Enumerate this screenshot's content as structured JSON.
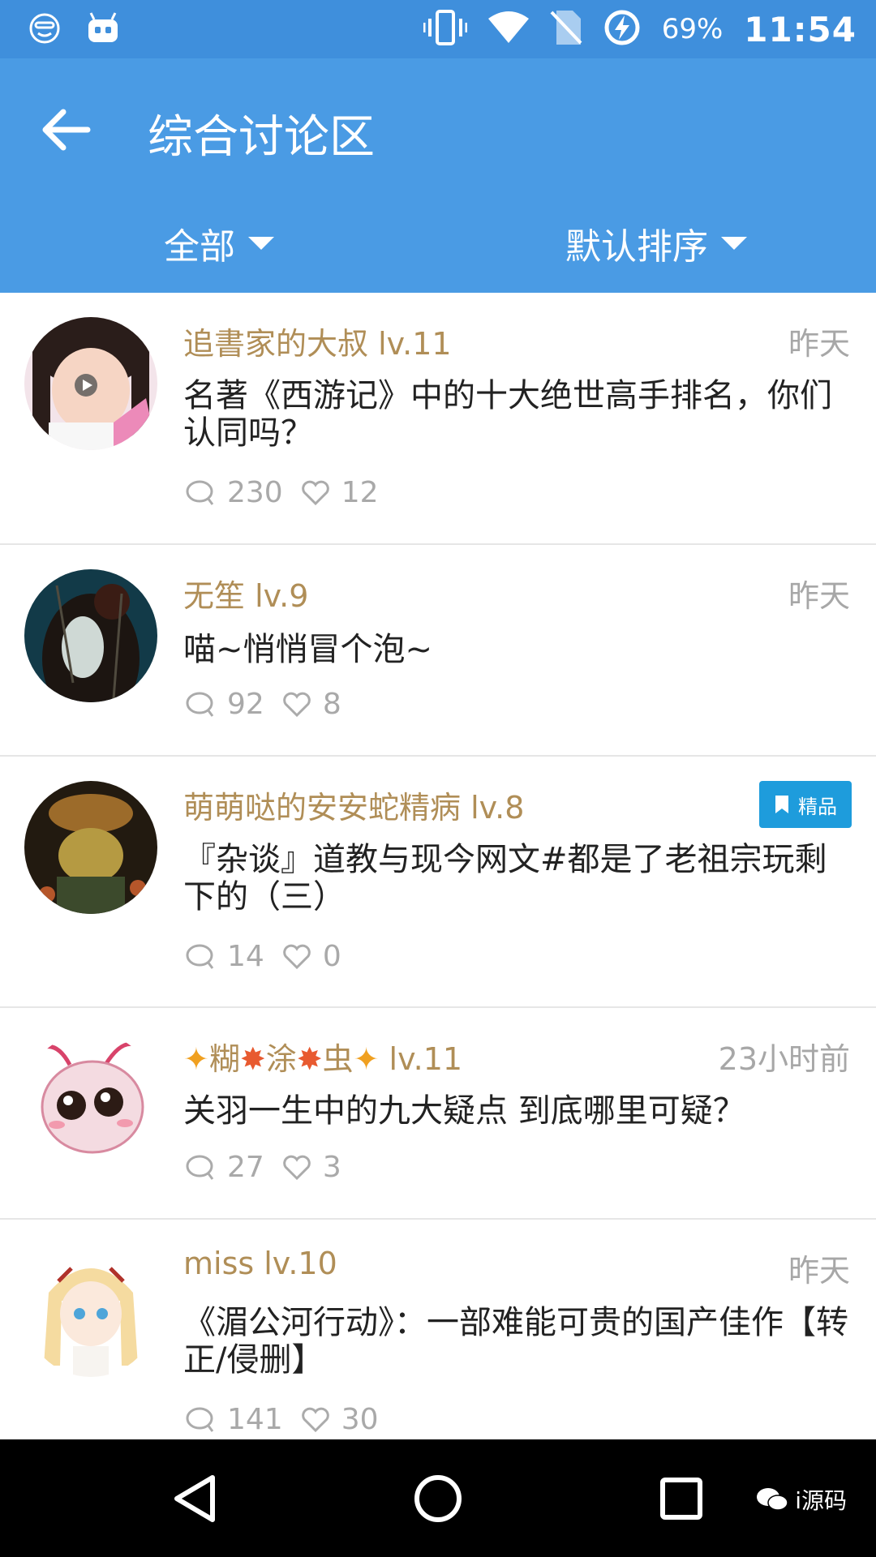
{
  "status_bar": {
    "battery": "69%",
    "time": "11:54",
    "icons": [
      "smiley-icon",
      "android-icon",
      "vibrate-icon",
      "wifi-icon",
      "no-sim-icon",
      "battery-charging-icon"
    ]
  },
  "header": {
    "title": "综合讨论区",
    "filter_label": "全部",
    "sort_label": "默认排序"
  },
  "posts": [
    {
      "author": "追書家的大叔 lv.11",
      "time": "昨天",
      "title": "名著《西游记》中的十大绝世高手排名，你们认同吗？",
      "comments": "230",
      "likes": "12"
    },
    {
      "author": "无笙 lv.9",
      "time": "昨天",
      "title": "喵~悄悄冒个泡~",
      "comments": "92",
      "likes": "8"
    },
    {
      "author": "萌萌哒的安安蛇精病 lv.8",
      "badge": "精品",
      "title": "『杂谈』道教与现今网文#都是了老祖宗玩剩下的（三）",
      "comments": "14",
      "likes": "0"
    },
    {
      "author_parts": [
        "糊",
        "涂",
        "虫"
      ],
      "author_level": "lv.11",
      "time": "23小时前",
      "title": "关羽一生中的九大疑点 到底哪里可疑？",
      "comments": "27",
      "likes": "3"
    },
    {
      "author": "miss lv.10",
      "time": "昨天",
      "title": "《湄公河行动》：一部难能可贵的国产佳作【转正/侵删】",
      "comments": "141",
      "likes": "30"
    }
  ],
  "watermark": "i源码",
  "colors": {
    "status_bar": "#3f8fdc",
    "app_bar": "#4a9be4",
    "author": "#b08e57",
    "badge": "#1e9cdc"
  }
}
